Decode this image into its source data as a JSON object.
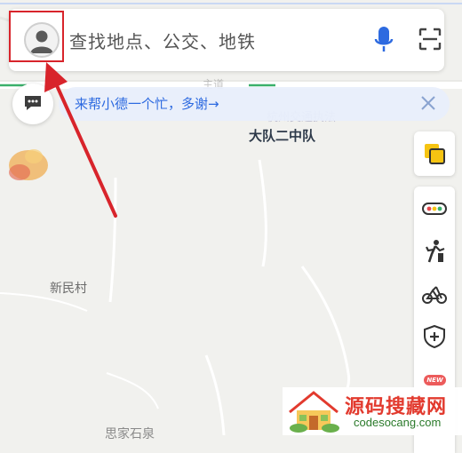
{
  "search": {
    "placeholder": "查找地点、公交、地铁",
    "avatar_icon": "user-avatar-icon",
    "mic_icon": "microphone-icon",
    "scan_icon": "scan-icon"
  },
  "notice": {
    "text": "来帮小德一个忙，多谢→",
    "close_icon": "close-icon",
    "chat_icon": "chat-bubble-icon"
  },
  "map": {
    "labels": {
      "dadui": "大队二中队",
      "xinmin": "新民村",
      "bottom": "思家石泉",
      "faded_top": "主道",
      "faded_traffic": "杭州交通执法"
    }
  },
  "tools": {
    "items": [
      "layers-icon",
      "traffic-light-icon",
      "walking-person-icon",
      "bicycle-icon",
      "shield-icon"
    ],
    "new_badge": "NEW"
  },
  "annotation": {
    "highlight_color": "#d8242b",
    "arrow_color": "#d8242b"
  },
  "watermark": {
    "title": "源码搜藏网",
    "domain": "codesocang.com"
  },
  "colors": {
    "accent_blue": "#2d6ae0",
    "brand_yellow": "#f6c412",
    "route_green": "#3ab06a"
  }
}
